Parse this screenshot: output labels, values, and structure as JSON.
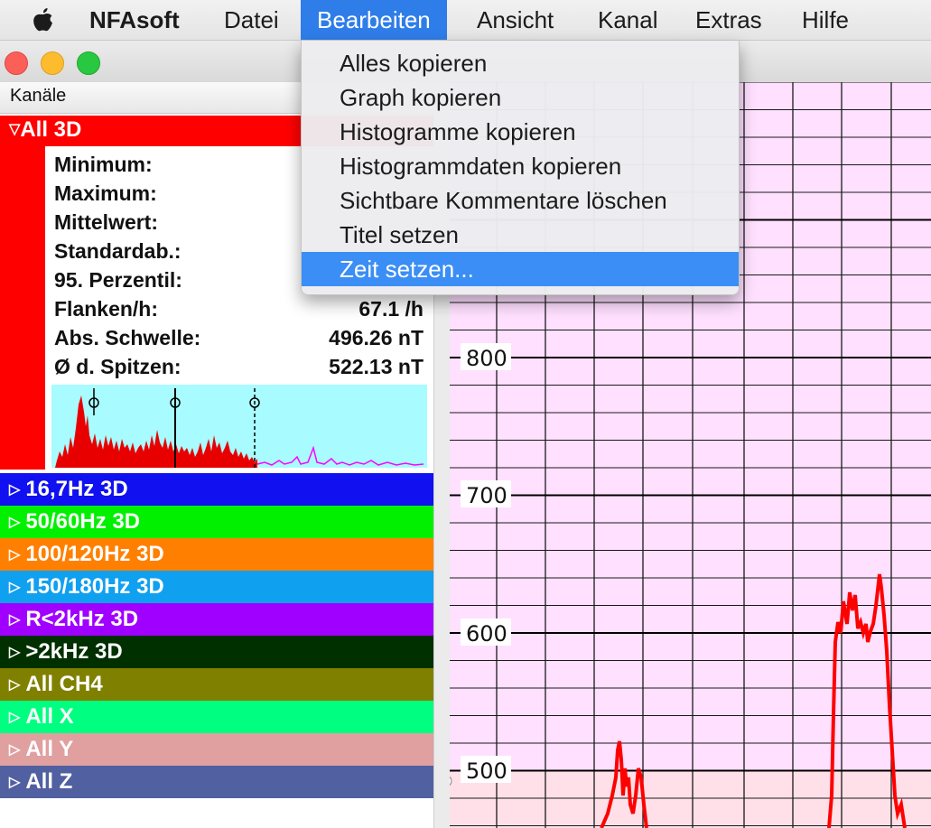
{
  "menubar": {
    "app": "NFAsoft",
    "items": [
      "Datei",
      "Bearbeiten",
      "Ansicht",
      "Kanal",
      "Extras",
      "Hilfe"
    ],
    "active_item": "Bearbeiten",
    "apple_icon": "apple-icon"
  },
  "edit_menu": {
    "items": [
      {
        "label": "Alles kopieren",
        "highlighted": false
      },
      {
        "label": "Graph kopieren",
        "highlighted": false
      },
      {
        "label": "Histogramme kopieren",
        "highlighted": false
      },
      {
        "label": "Histogrammdaten kopieren",
        "highlighted": false
      },
      {
        "label": "Sichtbare Kommentare löschen",
        "highlighted": false
      },
      {
        "label": "Titel setzen",
        "highlighted": false
      },
      {
        "label": "Zeit setzen...",
        "highlighted": true
      }
    ],
    "highlight_color": "#3a8ef5"
  },
  "sidebar": {
    "header": "Kanäle",
    "expanded_channel": {
      "name": "All 3D",
      "color": "#ff0000",
      "stats": [
        {
          "label": "Minimum:",
          "value": ""
        },
        {
          "label": "Maximum:",
          "value": ""
        },
        {
          "label": "Mittelwert:",
          "value": ""
        },
        {
          "label": "Standardab.:",
          "value": ""
        },
        {
          "label": "95. Perzentil:",
          "value": ""
        },
        {
          "label": "Flanken/h:",
          "value": "67.1 /h"
        },
        {
          "label": "Abs. Schwelle:",
          "value": "496.26 nT"
        },
        {
          "label": "Ø d. Spitzen:",
          "value": "522.13 nT"
        }
      ]
    },
    "channels": [
      {
        "name": "16,7Hz 3D",
        "color": "#1010f0"
      },
      {
        "name": "50/60Hz 3D",
        "color": "#00f000"
      },
      {
        "name": "100/120Hz 3D",
        "color": "#ff8000"
      },
      {
        "name": "150/180Hz 3D",
        "color": "#10a0f0"
      },
      {
        "name": "R<2kHz 3D",
        "color": "#a000ff"
      },
      {
        "name": ">2kHz 3D",
        "color": "#003000"
      },
      {
        "name": "All CH4",
        "color": "#808000"
      },
      {
        "name": "All X",
        "color": "#00ff80"
      },
      {
        "name": "All Y",
        "color": "#e0a0a0"
      },
      {
        "name": "All Z",
        "color": "#5060a0"
      }
    ]
  },
  "graph": {
    "y_ticks": [
      "800",
      "700",
      "600",
      "500"
    ],
    "background": "#ffe0ff",
    "lower_band": "#ffe0e8",
    "line_color": "#ff0000"
  }
}
